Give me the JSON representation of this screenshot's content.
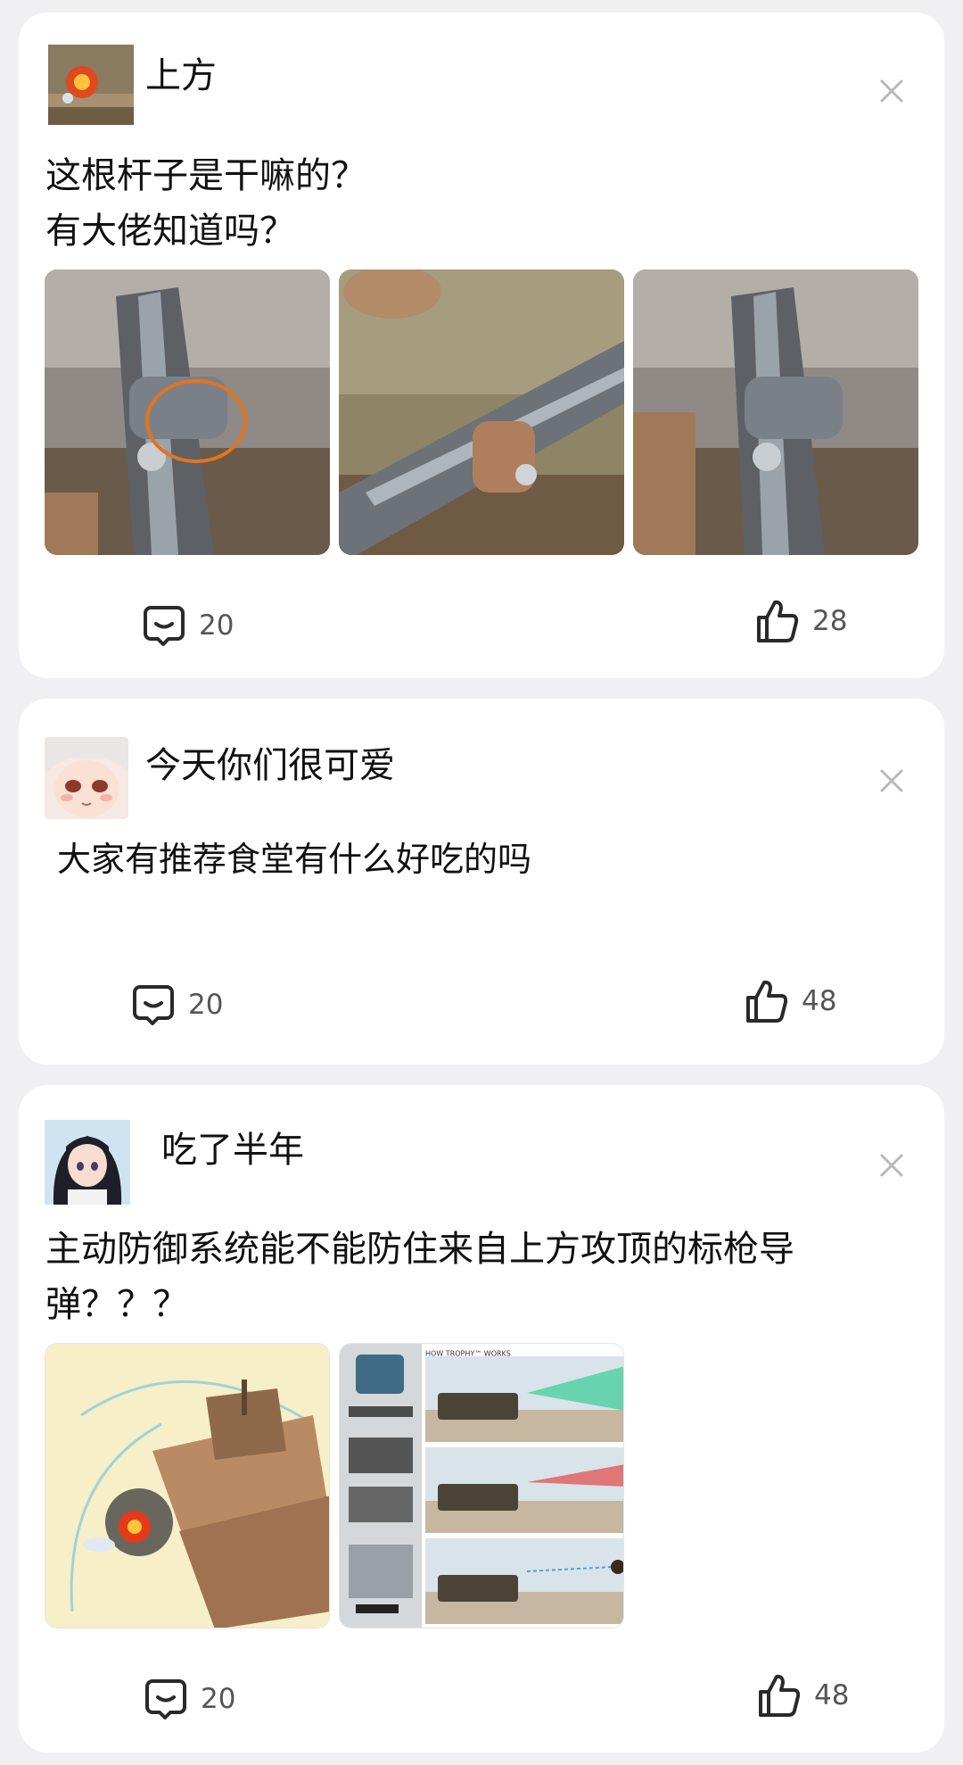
{
  "posts": [
    {
      "username": "上方",
      "text_lines": [
        "这根杆子是干嘛的？",
        "有大佬知道吗？"
      ],
      "images": [
        "gun-photo-1",
        "gun-photo-2",
        "gun-photo-3"
      ],
      "comments": "20",
      "likes": "28"
    },
    {
      "username": "今天你们很可爱",
      "text_lines": [
        "大家有推荐食堂有什么好吃的吗"
      ],
      "images": [],
      "comments": "20",
      "likes": "48"
    },
    {
      "username": "吃了半年",
      "text_lines": [
        "主动防御系统能不能防住来自上方攻顶的标枪导",
        "弹？？？"
      ],
      "images": [
        "tank-illustration",
        "trophy-infographic"
      ],
      "infographic_title": "HOW TROPHY™ WORKS",
      "comments": "20",
      "likes": "48"
    }
  ],
  "icons": {
    "comment": "comment-bubble-icon",
    "like": "thumbs-up-icon",
    "close": "close-icon"
  },
  "colors": {
    "background": "#f0f0f2",
    "card": "#ffffff",
    "icon": "#2a2a2a",
    "count": "#555555",
    "close": "#b8b8b8"
  }
}
